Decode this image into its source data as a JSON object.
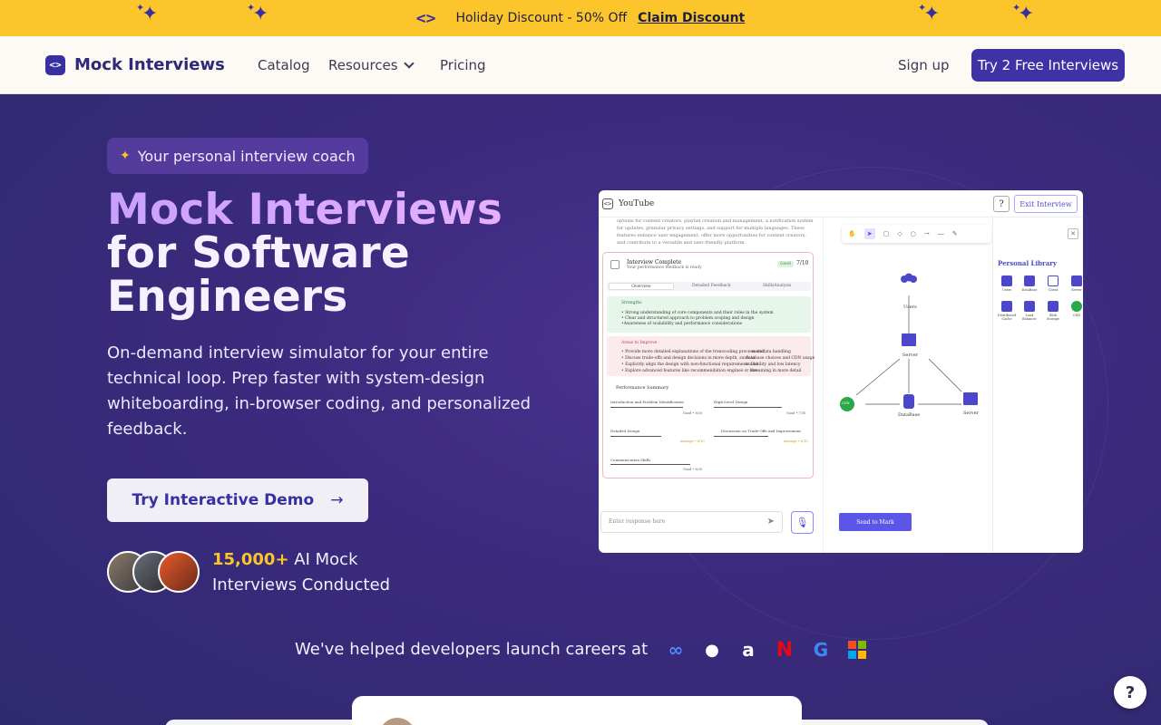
{
  "banner": {
    "promo_text": "Holiday Discount - 50% Off",
    "claim_link": "Claim Discount",
    "code_icon": "code-brackets-icon",
    "background": "#fcc52c"
  },
  "nav": {
    "brand": "Mock Interviews",
    "links": [
      "Catalog",
      "Resources",
      "Pricing"
    ],
    "signup": "Sign up",
    "cta": "Try 2 Free Interviews"
  },
  "hero": {
    "badge": "Your personal interview coach",
    "title_line1": "Mock Interviews",
    "title_line2": "for Software",
    "title_line3": "Engineers",
    "description": "On-demand interview simulator for your entire technical loop. Prep faster with system-design whiteboarding, in-browser coding, and personalized feedback.",
    "demo_button": "Try Interactive Demo",
    "stat_number": "15,000+",
    "stat_text_1": "AI Mock",
    "stat_text_2": "Interviews Conducted",
    "helped_text": "We've helped developers launch careers at",
    "companies": [
      "meta",
      "apple",
      "amazon",
      "netflix",
      "google",
      "microsoft"
    ]
  },
  "app_preview": {
    "window_title": "YouTube",
    "help_button": "?",
    "exit_button": "Exit Interview",
    "problem_text": "options for content creators, playlist creation and management, a notification system for updates, granular privacy settings, and support for multiple languages. These features enhance user engagement, offer more opportunities for content creators, and contribute to a versatile and user-friendly platform.",
    "result": {
      "title": "Interview Complete",
      "subtitle": "Your performance feedback is ready",
      "badge": "Good",
      "score": "7/10",
      "tabs": [
        "Overview",
        "Detailed Feedback",
        "SkillsAnalysis"
      ],
      "strengths_title": "Strengths",
      "strengths": [
        "• Strong understanding of core components and their roles in the system",
        "• Clear and structured approach to problem scoping and design",
        "•Awareness of scalability and performance considerations"
      ],
      "improve_title": "Areas to Improve",
      "improve_left": [
        "• Provide more detailed explanations of the transcoding process and",
        "• Discuss trade-offs and design decisions in more depth, such as",
        "• Explicitly align the design with non-functional requirements like",
        "• Explore advanced features like recommendation engines or live"
      ],
      "improve_right": [
        "metadata handling",
        "database choices and CDN usage",
        "scalability and low latency",
        "streaming in more detail"
      ],
      "perf_title": "Performance Summary",
      "metrics": [
        {
          "name": "Introduction and Problem Identification",
          "rating": "Good • 8/10"
        },
        {
          "name": "High-Level Design",
          "rating": "Good • 7/10"
        },
        {
          "name": "Detailed Design",
          "rating": "Average • 6/10"
        },
        {
          "name": "Discussion on Trade-Offs and Improvement",
          "rating": "Average • 6/10"
        },
        {
          "name": "Communication Skills",
          "rating": "Good • 8/10"
        }
      ]
    },
    "response_placeholder": "Enter response here",
    "send_mark": "Send to Mark",
    "diagram_labels": {
      "users": "Users",
      "server_top": "Server",
      "database": "DataBase",
      "server_right": "Server",
      "cdn": "CDN"
    },
    "library": {
      "title": "Personal Library",
      "items": [
        "Users",
        "DataBase",
        "Client",
        "Server",
        "Distributed Cache",
        "Load Balancer",
        "Blob Storage",
        "CDN"
      ]
    }
  },
  "help_fab": "?"
}
